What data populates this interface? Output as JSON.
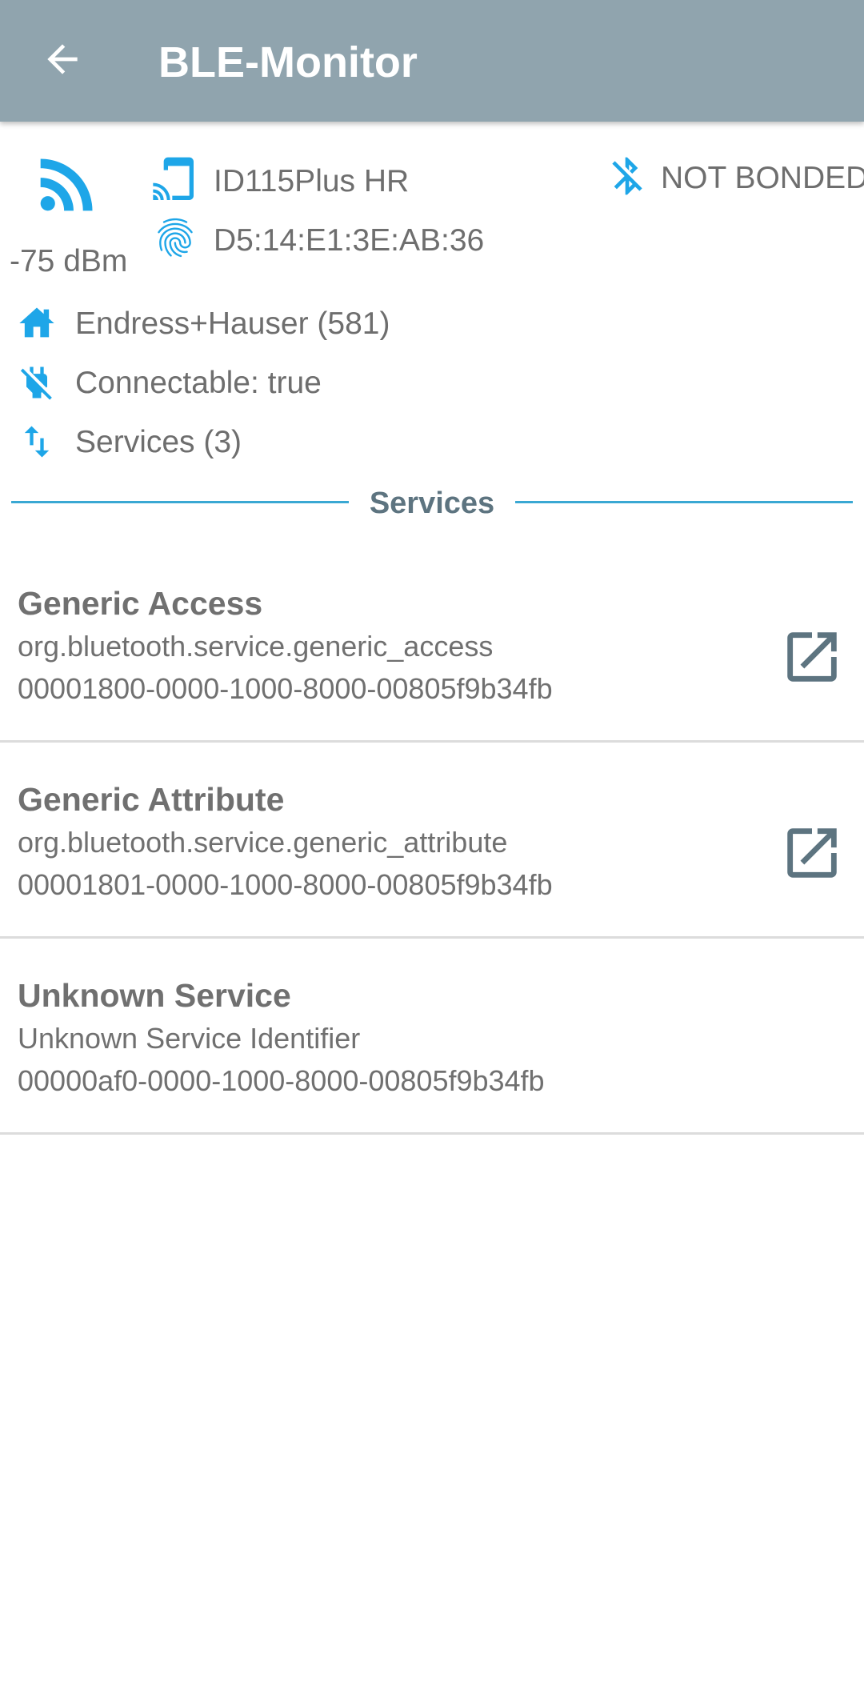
{
  "app": {
    "title": "BLE-Monitor",
    "back_icon": "arrow-left-icon"
  },
  "device": {
    "rssi": "-75 dBm",
    "name": "ID115Plus HR",
    "address": "D5:14:E1:3E:AB:36",
    "bond_status": "NOT BONDED",
    "manufacturer": "Endress+Hauser (581)",
    "connectable": "Connectable: true",
    "services_count": "Services (3)"
  },
  "section": {
    "services_label": "Services"
  },
  "services": [
    {
      "name": "Generic Access",
      "identifier": "org.bluetooth.service.generic_access",
      "uuid": "00001800-0000-1000-8000-00805f9b34fb",
      "has_link": true
    },
    {
      "name": "Generic Attribute",
      "identifier": "org.bluetooth.service.generic_attribute",
      "uuid": "00001801-0000-1000-8000-00805f9b34fb",
      "has_link": true
    },
    {
      "name": "Unknown Service",
      "identifier": "Unknown Service Identifier",
      "uuid": "00000af0-0000-1000-8000-00805f9b34fb",
      "has_link": false
    }
  ],
  "colors": {
    "appbar": "#90a4ae",
    "accent": "#1ea6e8",
    "divider": "#3aa8d3",
    "text": "#6e6e6e",
    "link_icon": "#5d7480"
  }
}
